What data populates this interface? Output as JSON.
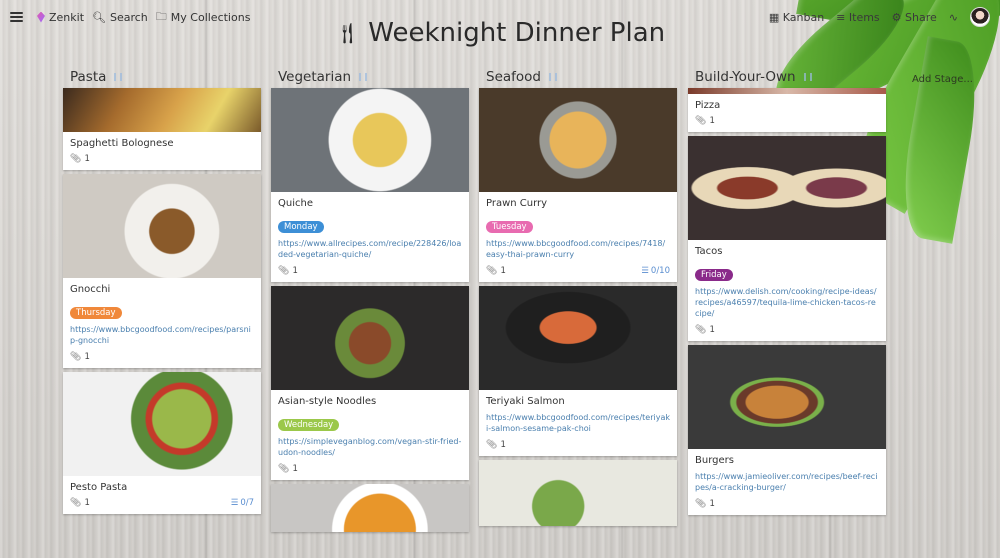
{
  "topbar": {
    "brand": "Zenkit",
    "search_label": "Search",
    "collections_label": "My Collections",
    "view_label": "Kanban",
    "items_label": "Items",
    "share_label": "Share"
  },
  "board": {
    "title": "Weeknight Dinner Plan",
    "title_icon": "fork-knife-icon",
    "add_stage_label": "Add Stage..."
  },
  "colors": {
    "monday": "#3d8fd6",
    "tuesday": "#e86bb0",
    "wednesday": "#9bc84a",
    "thursday": "#f0883a",
    "friday": "#8a2a8a"
  },
  "columns": [
    {
      "title": "Pasta",
      "cards": [
        {
          "name": "Spaghetti Bolognese",
          "attachments": "1",
          "image": "pasta-photo"
        },
        {
          "name": "Gnocchi",
          "tag": "Thursday",
          "link": "https://www.bbcgoodfood.com/recipes/parsnip-gnocchi",
          "attachments": "1",
          "image": "gnocchi-photo"
        },
        {
          "name": "Pesto Pasta",
          "attachments": "1",
          "checklist": "0/7",
          "image": "pesto-pasta-photo"
        }
      ]
    },
    {
      "title": "Vegetarian",
      "cards": [
        {
          "name": "Quiche",
          "tag": "Monday",
          "link": "https://www.allrecipes.com/recipe/228426/loaded-vegetarian-quiche/",
          "attachments": "1",
          "image": "quiche-photo"
        },
        {
          "name": "Asian-style Noodles",
          "tag": "Wednesday",
          "link": "https://simpleveganblog.com/vegan-stir-fried-udon-noodles/",
          "attachments": "1",
          "image": "noodles-photo"
        },
        {
          "name": "",
          "image": "soup-photo"
        }
      ]
    },
    {
      "title": "Seafood",
      "cards": [
        {
          "name": "Prawn Curry",
          "tag": "Tuesday",
          "link": "https://www.bbcgoodfood.com/recipes/7418/easy-thai-prawn-curry",
          "attachments": "1",
          "checklist": "0/10",
          "image": "prawn-curry-photo"
        },
        {
          "name": "Teriyaki Salmon",
          "link": "https://www.bbcgoodfood.com/recipes/teriyaki-salmon-sesame-pak-choi",
          "attachments": "1",
          "image": "salmon-photo"
        },
        {
          "name": "",
          "image": "salad-photo"
        }
      ]
    },
    {
      "title": "Build-Your-Own",
      "cards": [
        {
          "name": "Pizza",
          "attachments": "1",
          "image": "pizza-photo"
        },
        {
          "name": "Tacos",
          "tag": "Friday",
          "link": "https://www.delish.com/cooking/recipe-ideas/recipes/a46597/tequila-lime-chicken-tacos-recipe/",
          "attachments": "1",
          "image": "tacos-photo"
        },
        {
          "name": "Burgers",
          "link": "https://www.jamieoliver.com/recipes/beef-recipes/a-cracking-burger/",
          "attachments": "1",
          "image": "burger-photo"
        }
      ]
    }
  ]
}
